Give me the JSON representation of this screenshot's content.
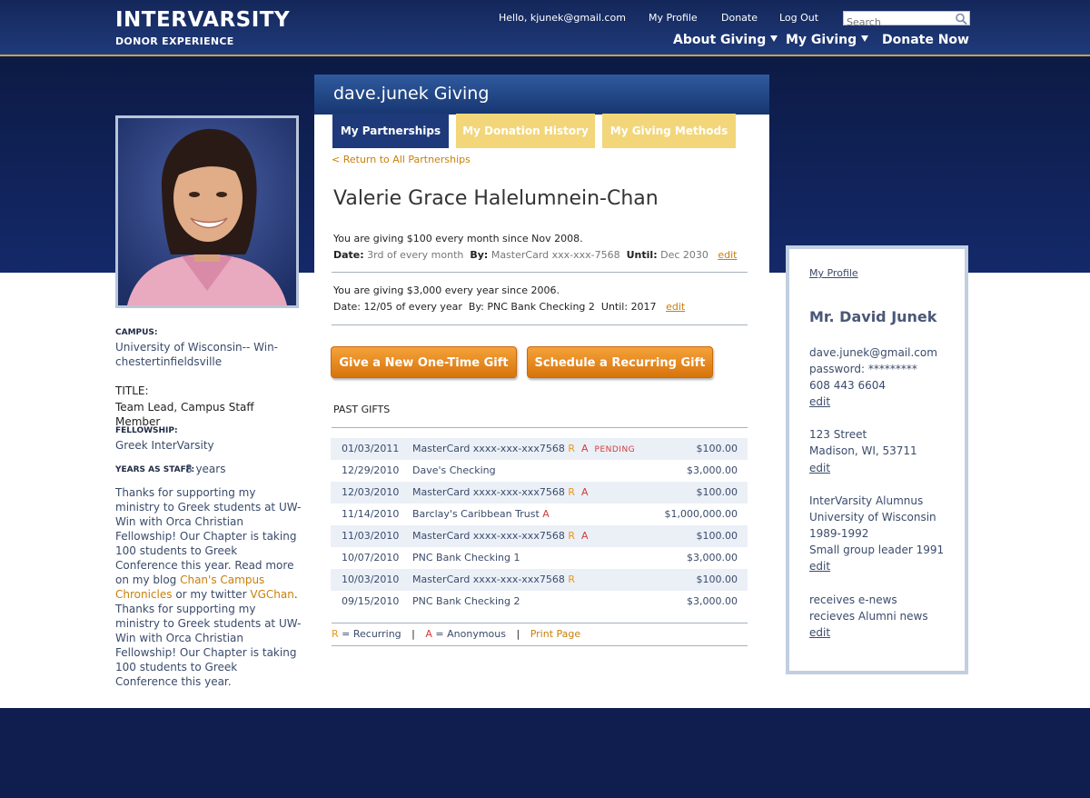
{
  "header": {
    "logo_line1": "INTERVARSITY",
    "logo_line2": "DONOR EXPERIENCE",
    "greeting": "Hello, kjunek@gmail.com",
    "links": [
      "My Profile",
      "Donate",
      "Log Out"
    ],
    "search_placeholder": "Search",
    "nav": [
      "About Giving",
      "My Giving",
      "Donate Now"
    ]
  },
  "panel": {
    "title": "dave.junek Giving",
    "tabs": [
      "My Partnerships",
      "My Donation History",
      "My Giving Methods"
    ],
    "active_tab": "My Partnerships",
    "back_link": "< Return to All Partnerships",
    "partner_name": "Valerie Grace Halelumnein-Chan"
  },
  "commitments": [
    {
      "summary": "You are giving $100 every month since Nov 2008.",
      "date_label": "Date:",
      "date": "3rd of every month",
      "by_label": "By:",
      "by": "MasterCard xxx-xxx-7568",
      "until_label": "Until:",
      "until": "Dec 2030",
      "edit": "edit"
    },
    {
      "summary": "You are giving $3,000 every year since 2006.",
      "date_label": "Date:",
      "date": "12/05 of every year",
      "by_label": "By:",
      "by": "PNC Bank Checking 2",
      "until_label": "Until:",
      "until": "2017",
      "edit": "edit"
    }
  ],
  "buttons": {
    "one_time": "Give a New One-Time Gift",
    "recurring": "Schedule a Recurring Gift"
  },
  "past_gifts": {
    "heading": "PAST GIFTS",
    "rows": [
      {
        "date": "01/03/2011",
        "source": "MasterCard xxxx-xxx-xxx7568",
        "r": "R",
        "a": "A",
        "status": "PENDING",
        "amount": "$100.00"
      },
      {
        "date": "12/29/2010",
        "source": "Dave's Checking",
        "r": "",
        "a": "",
        "status": "",
        "amount": "$3,000.00"
      },
      {
        "date": "12/03/2010",
        "source": "MasterCard xxxx-xxx-xxx7568",
        "r": "R",
        "a": "A",
        "status": "",
        "amount": "$100.00"
      },
      {
        "date": "11/14/2010",
        "source": "Barclay's Caribbean Trust",
        "r": "",
        "a": "A",
        "status": "",
        "amount": "$1,000,000.00"
      },
      {
        "date": "11/03/2010",
        "source": "MasterCard xxxx-xxx-xxx7568",
        "r": "R",
        "a": "A",
        "status": "",
        "amount": "$100.00"
      },
      {
        "date": "10/07/2010",
        "source": "PNC Bank Checking 1",
        "r": "",
        "a": "",
        "status": "",
        "amount": "$3,000.00"
      },
      {
        "date": "10/03/2010",
        "source": "MasterCard xxxx-xxx-xxx7568",
        "r": "R",
        "a": "",
        "status": "",
        "amount": "$100.00"
      },
      {
        "date": "09/15/2010",
        "source": "PNC Bank Checking 2",
        "r": "",
        "a": "",
        "status": "",
        "amount": "$3,000.00"
      }
    ]
  },
  "legend": {
    "r_key": "R",
    "r_text": "= Recurring",
    "a_key": "A",
    "a_text": "= Anonymous",
    "print": "Print Page"
  },
  "staff": {
    "campus_label": "CAMPUS:",
    "campus": "University of Wisconsin-- Win-chestertinfieldsville",
    "title_label": "TITLE:",
    "title": "Team Lead, Campus Staff Member",
    "fellowship_label": "FELLOWSHIP:",
    "fellowship": "Greek InterVarsity",
    "years_label": "YEARS AS STAFF:",
    "years": "8 years",
    "bio_1": "Thanks for supporting my ministry to Greek students at UW-Win with Orca Christian Fellowship! Our Chapter is taking 100 students to Greek Conference this year. Read more on my blog ",
    "blog_link": "Chan's Campus Chronicles",
    "bio_2": " or my twitter ",
    "twitter_link": "VGChan",
    "bio_3": ". Thanks for supporting my ministry to Greek students at UW-Win with Orca Christian Fellowship! Our Chapter is taking 100 students to Greek Conference this year."
  },
  "profile": {
    "link": "My Profile",
    "name": "Mr. David Junek",
    "email": "dave.junek@gmail.com",
    "password": "password: *********",
    "phone": "608 443 6604",
    "address1": "123 Street",
    "address2": "Madison, WI, 53711",
    "alumni1": "InterVarsity Alumnus",
    "alumni2": "University of Wisconsin",
    "alumni3": "1989-1992",
    "alumni4": "Small group leader 1991",
    "news1": "receives e-news",
    "news2": "recieves Alumni news",
    "edit": "edit"
  },
  "colors": {
    "navy": "#14275a",
    "accent_orange": "#e8961c",
    "link_orange": "#c97f0a",
    "tab_yellow": "#f2d679"
  }
}
